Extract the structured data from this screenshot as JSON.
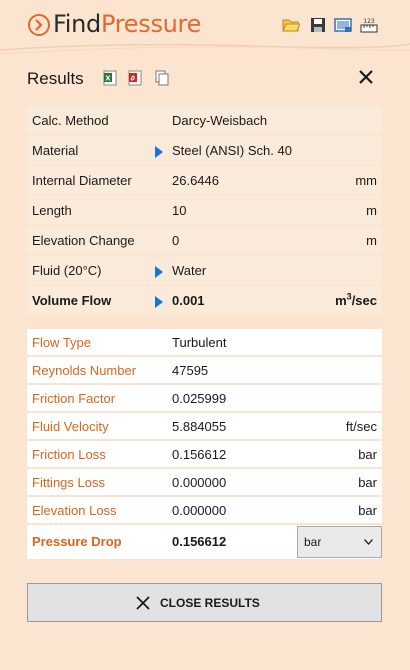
{
  "app": {
    "title_part1": "Find",
    "title_part2": "Pressure"
  },
  "toolbar_icons": [
    "folder-open-icon",
    "save-icon",
    "screenshot-icon",
    "units-ruler-icon"
  ],
  "results": {
    "title": "Results",
    "export_icons": [
      "excel-icon",
      "pdf-icon",
      "copy-icon"
    ],
    "inputs": [
      {
        "label": "Calc. Method",
        "value": "Darcy-Weisbach",
        "unit": "",
        "arrow": false
      },
      {
        "label": "Material",
        "value": "Steel (ANSI) Sch.  40",
        "unit": "",
        "arrow": true
      },
      {
        "label": "Internal Diameter",
        "value": "26.6446",
        "unit": "mm",
        "arrow": false
      },
      {
        "label": "Length",
        "value": "10",
        "unit": "m",
        "arrow": false
      },
      {
        "label": "Elevation Change",
        "value": "0",
        "unit": "m",
        "arrow": false
      },
      {
        "label": "Fluid (20°C)",
        "value": "Water",
        "unit": "",
        "arrow": true
      },
      {
        "label": "Volume Flow",
        "value": "0.001",
        "unit_base": "m",
        "unit_sup": "3",
        "unit_tail": "/sec",
        "arrow": true
      }
    ],
    "outputs": [
      {
        "label": "Flow Type",
        "value": "Turbulent",
        "unit": ""
      },
      {
        "label": "Reynolds Number",
        "value": "47595",
        "unit": ""
      },
      {
        "label": "Friction Factor",
        "value": "0.025999",
        "unit": ""
      },
      {
        "label": "Fluid Velocity",
        "value": "5.884055",
        "unit": "ft/sec"
      },
      {
        "label": "Friction Loss",
        "value": "0.156612",
        "unit": "bar"
      },
      {
        "label": "Fittings Loss",
        "value": "0.000000",
        "unit": "bar"
      },
      {
        "label": "Elevation Loss",
        "value": "0.000000",
        "unit": "bar"
      }
    ],
    "pressure_drop": {
      "label": "Pressure Drop",
      "value": "0.156612",
      "unit_selected": "bar"
    },
    "close_button": "CLOSE RESULTS"
  },
  "colors": {
    "accent": "#e2692a",
    "background": "#fbe5d1"
  }
}
